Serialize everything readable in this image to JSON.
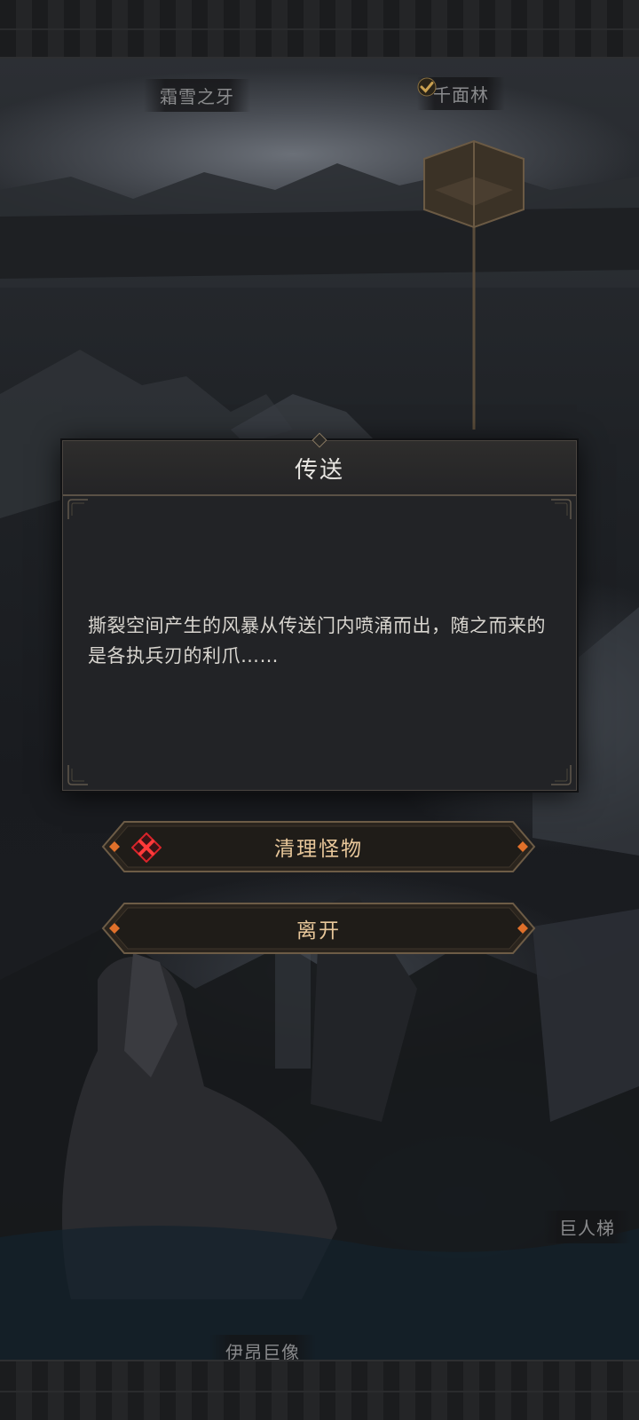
{
  "map": {
    "top_left_label": "霜雪之牙",
    "top_right_label": "千面林",
    "right_label": "巨人梯",
    "bottom_label": "伊昂巨像"
  },
  "dialog": {
    "title": "传送",
    "body": "撕裂空间产生的风暴从传送门内喷涌而出，随之而来的是各执兵刃的利爪……"
  },
  "buttons": {
    "clear_monsters": "清理怪物",
    "leave": "离开"
  },
  "colors": {
    "button_text": "#e8c79a",
    "accent_orange": "#e0702a",
    "danger_red": "#d8242a",
    "check_gold": "#c9a050"
  }
}
